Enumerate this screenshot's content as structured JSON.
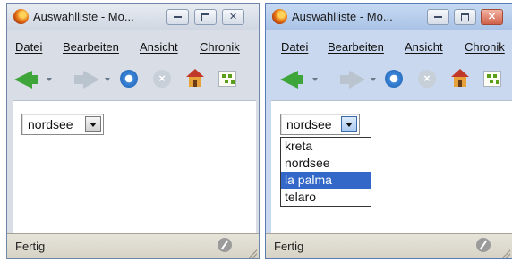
{
  "windows": [
    {
      "title": "Auswahlliste - Mo...",
      "menu": [
        "Datei",
        "Bearbeiten",
        "Ansicht",
        "Chronik"
      ],
      "select_value": "nordsee",
      "status": "Fertig"
    },
    {
      "title": "Auswahlliste - Mo...",
      "menu": [
        "Datei",
        "Bearbeiten",
        "Ansicht",
        "Chronik"
      ],
      "select_value": "nordsee",
      "options": [
        "kreta",
        "nordsee",
        "la palma",
        "telaro"
      ],
      "highlighted_option": "la palma",
      "status": "Fertig"
    }
  ],
  "icons": {
    "browser": "firefox-logo",
    "back": "back-arrow-icon",
    "forward": "forward-arrow-icon",
    "reload": "reload-icon",
    "stop": "stop-icon",
    "home": "home-icon",
    "extension": "extension-icon"
  },
  "colors": {
    "highlight": "#3368c8",
    "close_button": "#d0614a",
    "back_arrow": "#3ea53a"
  }
}
